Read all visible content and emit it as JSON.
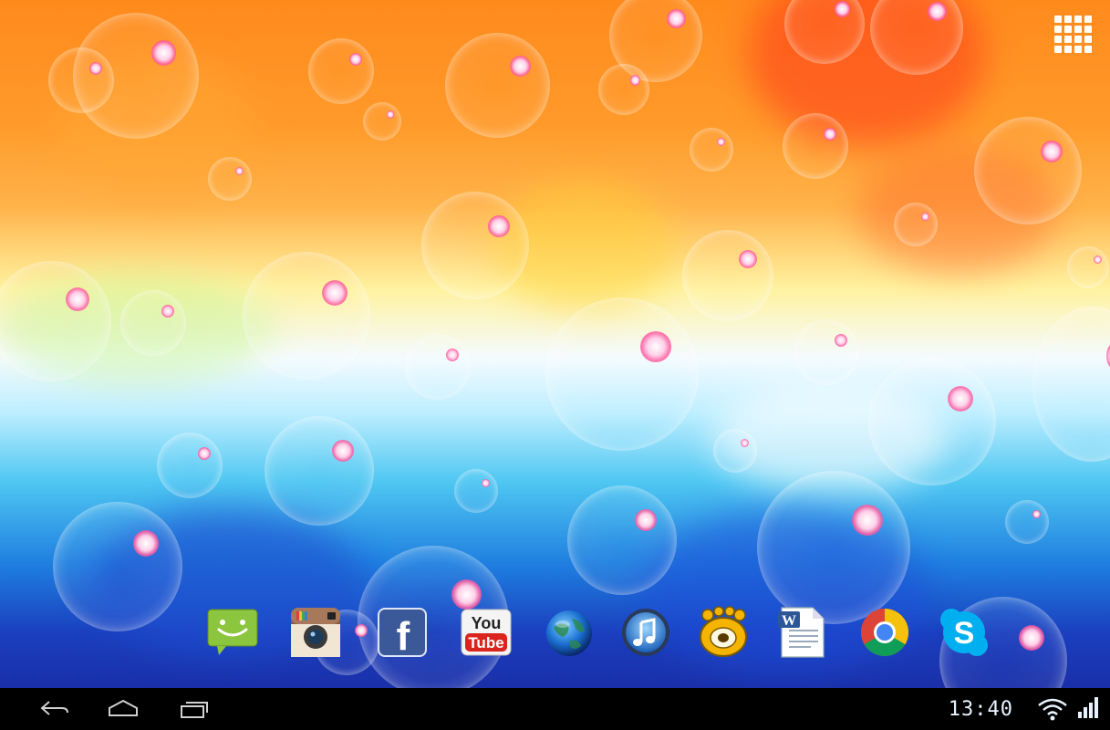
{
  "launcher": {
    "all_apps_icon": "app-drawer-grid-icon"
  },
  "dock": {
    "apps": [
      {
        "name": "Messaging",
        "icon": "sms-icon",
        "color": "#8cc63f"
      },
      {
        "name": "Instagram",
        "icon": "camera-icon",
        "color": "#8a5a3a"
      },
      {
        "name": "Facebook",
        "icon": "facebook-icon",
        "color": "#3b5998",
        "glyph": "f"
      },
      {
        "name": "YouTube",
        "icon": "youtube-icon",
        "color": "#d9251d",
        "line1": "You",
        "line2": "Tube"
      },
      {
        "name": "Browser",
        "icon": "globe-icon",
        "color": "#1a6fd1"
      },
      {
        "name": "Music",
        "icon": "music-icon",
        "color": "#2a7ed8"
      },
      {
        "name": "GOM Player",
        "icon": "gom-player-icon",
        "color": "#f5b400"
      },
      {
        "name": "Word",
        "icon": "word-document-icon",
        "color": "#2b5797",
        "glyph": "W"
      },
      {
        "name": "Chrome",
        "icon": "chrome-icon",
        "color": "#db4437"
      },
      {
        "name": "Skype",
        "icon": "skype-icon",
        "color": "#00aff0",
        "glyph": "S"
      }
    ]
  },
  "navbar": {
    "back_icon": "back-icon",
    "home_icon": "home-icon",
    "recents_icon": "recent-apps-icon"
  },
  "status": {
    "time": "13:40",
    "wifi_icon": "wifi-icon",
    "signal_icon": "signal-icon"
  }
}
